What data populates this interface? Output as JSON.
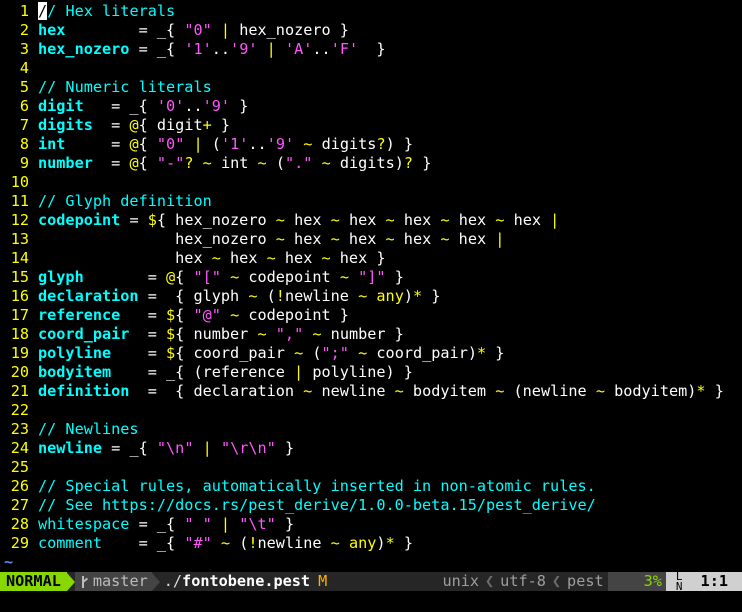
{
  "editor": {
    "lines": [
      {
        "n": "1",
        "tokens": [
          {
            "t": "/",
            "c": "cursor"
          },
          {
            "t": "/ Hex literals",
            "c": "t-cmt"
          }
        ]
      },
      {
        "n": "2",
        "tokens": [
          {
            "t": "hex",
            "c": "t-rule"
          },
          {
            "t": "        = ",
            "c": "t-txt"
          },
          {
            "t": "_{",
            "c": "t-txt"
          },
          {
            "t": " ",
            "c": "t-txt"
          },
          {
            "t": "\"0\"",
            "c": "t-str"
          },
          {
            "t": " ",
            "c": "t-txt"
          },
          {
            "t": "|",
            "c": "t-op"
          },
          {
            "t": " hex_nozero }",
            "c": "t-txt"
          }
        ]
      },
      {
        "n": "3",
        "tokens": [
          {
            "t": "hex_nozero",
            "c": "t-rule"
          },
          {
            "t": " = _{ ",
            "c": "t-txt"
          },
          {
            "t": "'1'",
            "c": "t-str"
          },
          {
            "t": "..",
            "c": "t-txt"
          },
          {
            "t": "'9'",
            "c": "t-str"
          },
          {
            "t": " ",
            "c": "t-txt"
          },
          {
            "t": "|",
            "c": "t-op"
          },
          {
            "t": " ",
            "c": "t-txt"
          },
          {
            "t": "'A'",
            "c": "t-str"
          },
          {
            "t": "..",
            "c": "t-txt"
          },
          {
            "t": "'F'",
            "c": "t-str"
          },
          {
            "t": "  }",
            "c": "t-txt"
          }
        ]
      },
      {
        "n": "4",
        "tokens": []
      },
      {
        "n": "5",
        "tokens": [
          {
            "t": "// Numeric literals",
            "c": "t-cmt"
          }
        ]
      },
      {
        "n": "6",
        "tokens": [
          {
            "t": "digit",
            "c": "t-rule"
          },
          {
            "t": "   = _{ ",
            "c": "t-txt"
          },
          {
            "t": "'0'",
            "c": "t-str"
          },
          {
            "t": "..",
            "c": "t-txt"
          },
          {
            "t": "'9'",
            "c": "t-str"
          },
          {
            "t": " }",
            "c": "t-txt"
          }
        ]
      },
      {
        "n": "7",
        "tokens": [
          {
            "t": "digits",
            "c": "t-rule"
          },
          {
            "t": "  = ",
            "c": "t-txt"
          },
          {
            "t": "@",
            "c": "t-op"
          },
          {
            "t": "{ digit",
            "c": "t-txt"
          },
          {
            "t": "+",
            "c": "t-op"
          },
          {
            "t": " }",
            "c": "t-txt"
          }
        ]
      },
      {
        "n": "8",
        "tokens": [
          {
            "t": "int",
            "c": "t-rule"
          },
          {
            "t": "     = ",
            "c": "t-txt"
          },
          {
            "t": "@",
            "c": "t-op"
          },
          {
            "t": "{ ",
            "c": "t-txt"
          },
          {
            "t": "\"0\"",
            "c": "t-str"
          },
          {
            "t": " ",
            "c": "t-txt"
          },
          {
            "t": "|",
            "c": "t-op"
          },
          {
            "t": " (",
            "c": "t-txt"
          },
          {
            "t": "'1'",
            "c": "t-str"
          },
          {
            "t": "..",
            "c": "t-txt"
          },
          {
            "t": "'9'",
            "c": "t-str"
          },
          {
            "t": " ",
            "c": "t-txt"
          },
          {
            "t": "~",
            "c": "t-op"
          },
          {
            "t": " digits",
            "c": "t-txt"
          },
          {
            "t": "?",
            "c": "t-op"
          },
          {
            "t": ") }",
            "c": "t-txt"
          }
        ]
      },
      {
        "n": "9",
        "tokens": [
          {
            "t": "number",
            "c": "t-rule"
          },
          {
            "t": "  = ",
            "c": "t-txt"
          },
          {
            "t": "@",
            "c": "t-op"
          },
          {
            "t": "{ ",
            "c": "t-txt"
          },
          {
            "t": "\"-\"",
            "c": "t-str"
          },
          {
            "t": "?",
            "c": "t-op"
          },
          {
            "t": " ",
            "c": "t-txt"
          },
          {
            "t": "~",
            "c": "t-op"
          },
          {
            "t": " int ",
            "c": "t-txt"
          },
          {
            "t": "~",
            "c": "t-op"
          },
          {
            "t": " (",
            "c": "t-txt"
          },
          {
            "t": "\".\"",
            "c": "t-str"
          },
          {
            "t": " ",
            "c": "t-txt"
          },
          {
            "t": "~",
            "c": "t-op"
          },
          {
            "t": " digits)",
            "c": "t-txt"
          },
          {
            "t": "?",
            "c": "t-op"
          },
          {
            "t": " }",
            "c": "t-txt"
          }
        ]
      },
      {
        "n": "10",
        "tokens": []
      },
      {
        "n": "11",
        "tokens": [
          {
            "t": "// Glyph definition",
            "c": "t-cmt"
          }
        ]
      },
      {
        "n": "12",
        "tokens": [
          {
            "t": "codepoint",
            "c": "t-rule"
          },
          {
            "t": " = ",
            "c": "t-txt"
          },
          {
            "t": "$",
            "c": "t-op"
          },
          {
            "t": "{ hex_nozero ",
            "c": "t-txt"
          },
          {
            "t": "~",
            "c": "t-op"
          },
          {
            "t": " hex ",
            "c": "t-txt"
          },
          {
            "t": "~",
            "c": "t-op"
          },
          {
            "t": " hex ",
            "c": "t-txt"
          },
          {
            "t": "~",
            "c": "t-op"
          },
          {
            "t": " hex ",
            "c": "t-txt"
          },
          {
            "t": "~",
            "c": "t-op"
          },
          {
            "t": " hex ",
            "c": "t-txt"
          },
          {
            "t": "~",
            "c": "t-op"
          },
          {
            "t": " hex ",
            "c": "t-txt"
          },
          {
            "t": "|",
            "c": "t-op"
          }
        ]
      },
      {
        "n": "13",
        "tokens": [
          {
            "t": "               hex_nozero ",
            "c": "t-txt"
          },
          {
            "t": "~",
            "c": "t-op"
          },
          {
            "t": " hex ",
            "c": "t-txt"
          },
          {
            "t": "~",
            "c": "t-op"
          },
          {
            "t": " hex ",
            "c": "t-txt"
          },
          {
            "t": "~",
            "c": "t-op"
          },
          {
            "t": " hex ",
            "c": "t-txt"
          },
          {
            "t": "~",
            "c": "t-op"
          },
          {
            "t": " hex ",
            "c": "t-txt"
          },
          {
            "t": "|",
            "c": "t-op"
          }
        ]
      },
      {
        "n": "14",
        "tokens": [
          {
            "t": "               hex ",
            "c": "t-txt"
          },
          {
            "t": "~",
            "c": "t-op"
          },
          {
            "t": " hex ",
            "c": "t-txt"
          },
          {
            "t": "~",
            "c": "t-op"
          },
          {
            "t": " hex ",
            "c": "t-txt"
          },
          {
            "t": "~",
            "c": "t-op"
          },
          {
            "t": " hex }",
            "c": "t-txt"
          }
        ]
      },
      {
        "n": "15",
        "tokens": [
          {
            "t": "glyph",
            "c": "t-rule"
          },
          {
            "t": "       = ",
            "c": "t-txt"
          },
          {
            "t": "@",
            "c": "t-op"
          },
          {
            "t": "{ ",
            "c": "t-txt"
          },
          {
            "t": "\"[\"",
            "c": "t-str"
          },
          {
            "t": " ",
            "c": "t-txt"
          },
          {
            "t": "~",
            "c": "t-op"
          },
          {
            "t": " codepoint ",
            "c": "t-txt"
          },
          {
            "t": "~",
            "c": "t-op"
          },
          {
            "t": " ",
            "c": "t-txt"
          },
          {
            "t": "\"]\"",
            "c": "t-str"
          },
          {
            "t": " }",
            "c": "t-txt"
          }
        ]
      },
      {
        "n": "16",
        "tokens": [
          {
            "t": "declaration",
            "c": "t-rule"
          },
          {
            "t": " =  { glyph ",
            "c": "t-txt"
          },
          {
            "t": "~",
            "c": "t-op"
          },
          {
            "t": " (",
            "c": "t-txt"
          },
          {
            "t": "!",
            "c": "t-op"
          },
          {
            "t": "newline ",
            "c": "t-txt"
          },
          {
            "t": "~",
            "c": "t-op"
          },
          {
            "t": " ",
            "c": "t-txt"
          },
          {
            "t": "any",
            "c": "t-op"
          },
          {
            "t": ")",
            "c": "t-txt"
          },
          {
            "t": "*",
            "c": "t-op"
          },
          {
            "t": " }",
            "c": "t-txt"
          }
        ]
      },
      {
        "n": "17",
        "tokens": [
          {
            "t": "reference",
            "c": "t-rule"
          },
          {
            "t": "   = ",
            "c": "t-txt"
          },
          {
            "t": "$",
            "c": "t-op"
          },
          {
            "t": "{ ",
            "c": "t-txt"
          },
          {
            "t": "\"@\"",
            "c": "t-str"
          },
          {
            "t": " ",
            "c": "t-txt"
          },
          {
            "t": "~",
            "c": "t-op"
          },
          {
            "t": " codepoint }",
            "c": "t-txt"
          }
        ]
      },
      {
        "n": "18",
        "tokens": [
          {
            "t": "coord_pair",
            "c": "t-rule"
          },
          {
            "t": "  = ",
            "c": "t-txt"
          },
          {
            "t": "$",
            "c": "t-op"
          },
          {
            "t": "{ number ",
            "c": "t-txt"
          },
          {
            "t": "~",
            "c": "t-op"
          },
          {
            "t": " ",
            "c": "t-txt"
          },
          {
            "t": "\",\"",
            "c": "t-str"
          },
          {
            "t": " ",
            "c": "t-txt"
          },
          {
            "t": "~",
            "c": "t-op"
          },
          {
            "t": " number }",
            "c": "t-txt"
          }
        ]
      },
      {
        "n": "19",
        "tokens": [
          {
            "t": "polyline",
            "c": "t-rule"
          },
          {
            "t": "    = ",
            "c": "t-txt"
          },
          {
            "t": "$",
            "c": "t-op"
          },
          {
            "t": "{ coord_pair ",
            "c": "t-txt"
          },
          {
            "t": "~",
            "c": "t-op"
          },
          {
            "t": " (",
            "c": "t-txt"
          },
          {
            "t": "\";\"",
            "c": "t-str"
          },
          {
            "t": " ",
            "c": "t-txt"
          },
          {
            "t": "~",
            "c": "t-op"
          },
          {
            "t": " coord_pair)",
            "c": "t-txt"
          },
          {
            "t": "*",
            "c": "t-op"
          },
          {
            "t": " }",
            "c": "t-txt"
          }
        ]
      },
      {
        "n": "20",
        "tokens": [
          {
            "t": "bodyitem",
            "c": "t-rule"
          },
          {
            "t": "    = _{ (reference ",
            "c": "t-txt"
          },
          {
            "t": "|",
            "c": "t-op"
          },
          {
            "t": " polyline) }",
            "c": "t-txt"
          }
        ]
      },
      {
        "n": "21",
        "tokens": [
          {
            "t": "definition",
            "c": "t-rule"
          },
          {
            "t": "  =  { declaration ",
            "c": "t-txt"
          },
          {
            "t": "~",
            "c": "t-op"
          },
          {
            "t": " newline ",
            "c": "t-txt"
          },
          {
            "t": "~",
            "c": "t-op"
          },
          {
            "t": " bodyitem ",
            "c": "t-txt"
          },
          {
            "t": "~",
            "c": "t-op"
          },
          {
            "t": " (newline ",
            "c": "t-txt"
          },
          {
            "t": "~",
            "c": "t-op"
          },
          {
            "t": " bodyitem)",
            "c": "t-txt"
          },
          {
            "t": "*",
            "c": "t-op"
          },
          {
            "t": " }",
            "c": "t-txt"
          }
        ]
      },
      {
        "n": "22",
        "tokens": []
      },
      {
        "n": "23",
        "tokens": [
          {
            "t": "// Newlines",
            "c": "t-cmt"
          }
        ]
      },
      {
        "n": "24",
        "tokens": [
          {
            "t": "newline",
            "c": "t-rule"
          },
          {
            "t": " = _{ ",
            "c": "t-txt"
          },
          {
            "t": "\"\\n\"",
            "c": "t-str"
          },
          {
            "t": " ",
            "c": "t-txt"
          },
          {
            "t": "|",
            "c": "t-op"
          },
          {
            "t": " ",
            "c": "t-txt"
          },
          {
            "t": "\"\\r\\n\"",
            "c": "t-str"
          },
          {
            "t": " }",
            "c": "t-txt"
          }
        ]
      },
      {
        "n": "25",
        "tokens": []
      },
      {
        "n": "26",
        "tokens": [
          {
            "t": "// Special rules, automatically inserted in non-atomic rules.",
            "c": "t-cmt"
          }
        ]
      },
      {
        "n": "27",
        "tokens": [
          {
            "t": "// See https://docs.rs/pest_derive/1.0.0-beta.15/pest_derive/",
            "c": "t-cmt"
          }
        ]
      },
      {
        "n": "28",
        "tokens": [
          {
            "t": "whitespace",
            "c": "t-rule-plain"
          },
          {
            "t": " = _{ ",
            "c": "t-txt"
          },
          {
            "t": "\" \"",
            "c": "t-str"
          },
          {
            "t": " ",
            "c": "t-txt"
          },
          {
            "t": "|",
            "c": "t-op"
          },
          {
            "t": " ",
            "c": "t-txt"
          },
          {
            "t": "\"\\t\"",
            "c": "t-str"
          },
          {
            "t": " }",
            "c": "t-txt"
          }
        ]
      },
      {
        "n": "29",
        "tokens": [
          {
            "t": "comment",
            "c": "t-rule-plain"
          },
          {
            "t": "    = _{ ",
            "c": "t-txt"
          },
          {
            "t": "\"#\"",
            "c": "t-str"
          },
          {
            "t": " ",
            "c": "t-txt"
          },
          {
            "t": "~",
            "c": "t-op"
          },
          {
            "t": " (",
            "c": "t-txt"
          },
          {
            "t": "!",
            "c": "t-op"
          },
          {
            "t": "newline ",
            "c": "t-txt"
          },
          {
            "t": "~",
            "c": "t-op"
          },
          {
            "t": " ",
            "c": "t-txt"
          },
          {
            "t": "any",
            "c": "t-op"
          },
          {
            "t": ")",
            "c": "t-txt"
          },
          {
            "t": "*",
            "c": "t-op"
          },
          {
            "t": " }",
            "c": "t-txt"
          }
        ]
      }
    ],
    "empty_line_marker": "~"
  },
  "statusline": {
    "mode": "NORMAL",
    "branch": "master",
    "file_prefix": "./",
    "file_name": "fontobene.pest",
    "modified_flag": "M",
    "fileformat": "unix",
    "encoding": "utf-8",
    "filetype": "pest",
    "percent": "3%",
    "position_line": "1",
    "position_col": ":1",
    "separator": "❮"
  },
  "colors": {
    "mode_bg": "#87d700",
    "rule": "#00ffff",
    "string": "#ff55ff",
    "operator": "#ffff00",
    "line_number": "#ffff00"
  }
}
